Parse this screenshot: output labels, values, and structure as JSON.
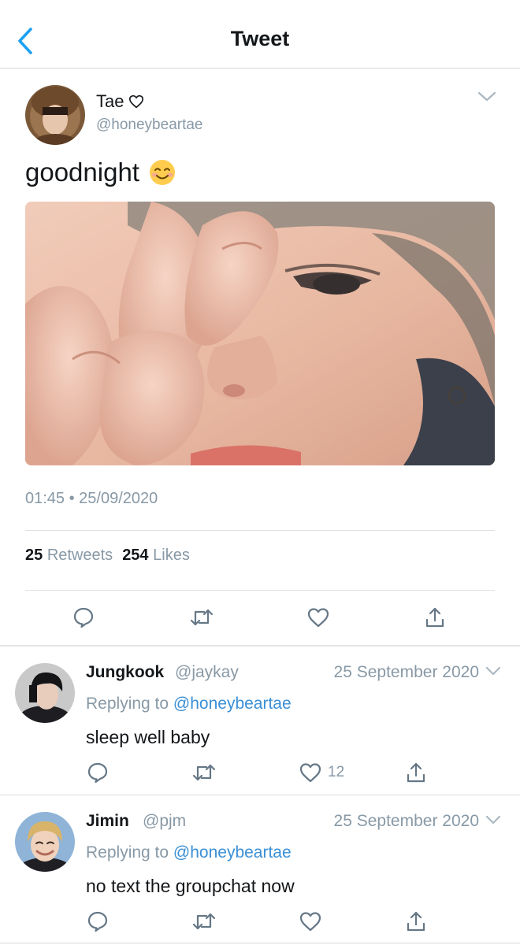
{
  "nav": {
    "title": "Tweet",
    "back_icon": "chevron-left-icon"
  },
  "tweet": {
    "author_name": "Tae",
    "author_handle": "@honeybeartae",
    "text": "goodnight",
    "emoji": "😊",
    "timestamp": "01:45 • 25/09/2020",
    "retweets_count": "25",
    "retweets_label": "Retweets",
    "likes_count": "254",
    "likes_label": "Likes"
  },
  "replies": [
    {
      "name": "Jungkook",
      "handle": "@jaykay",
      "date": "25 September 2020",
      "replying_prefix": "Replying to",
      "replying_to": "@honeybeartae",
      "text": "sleep well baby",
      "like_count": "12"
    },
    {
      "name": "Jimin",
      "handle": "@pjm",
      "date": "25 September 2020",
      "replying_prefix": "Replying to",
      "replying_to": "@honeybeartae",
      "text": "no text the groupchat now",
      "like_count": ""
    }
  ],
  "colors": {
    "accent": "#1da1f2",
    "secondary_text": "#8899a6",
    "primary_text": "#14171a",
    "divider": "#d4d8dc"
  },
  "icons": [
    "reply-icon",
    "retweet-icon",
    "like-icon",
    "share-icon",
    "chevron-down-icon",
    "heart-outline-icon"
  ]
}
